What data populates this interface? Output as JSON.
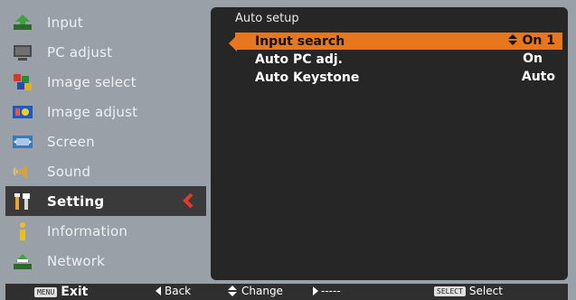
{
  "sidebar": {
    "items": [
      {
        "label": "Input",
        "icon": "input-icon"
      },
      {
        "label": "PC adjust",
        "icon": "pc-adjust-icon"
      },
      {
        "label": "Image select",
        "icon": "image-select-icon"
      },
      {
        "label": "Image adjust",
        "icon": "image-adjust-icon"
      },
      {
        "label": "Screen",
        "icon": "screen-icon"
      },
      {
        "label": "Sound",
        "icon": "sound-icon"
      },
      {
        "label": "Setting",
        "icon": "setting-icon"
      },
      {
        "label": "Information",
        "icon": "information-icon"
      },
      {
        "label": "Network",
        "icon": "network-icon"
      }
    ],
    "selected_index": 6
  },
  "panel": {
    "title": "Auto setup",
    "rows": [
      {
        "label": "Input search",
        "value": "On 1"
      },
      {
        "label": "Auto PC adj.",
        "value": "On"
      },
      {
        "label": "Auto Keystone",
        "value": "Auto"
      }
    ]
  },
  "footer": {
    "menu_key": "MENU",
    "exit_label": "Exit",
    "back_label": "Back",
    "change_label": "Change",
    "next_label": "-----",
    "select_key": "SELECT",
    "select_label": "Select"
  },
  "colors": {
    "background": "#9aa0a8",
    "panel": "#262626",
    "highlight": "#e6771f",
    "selected_item": "#3a3a3a",
    "selection_arrow": "#e53a2a"
  }
}
